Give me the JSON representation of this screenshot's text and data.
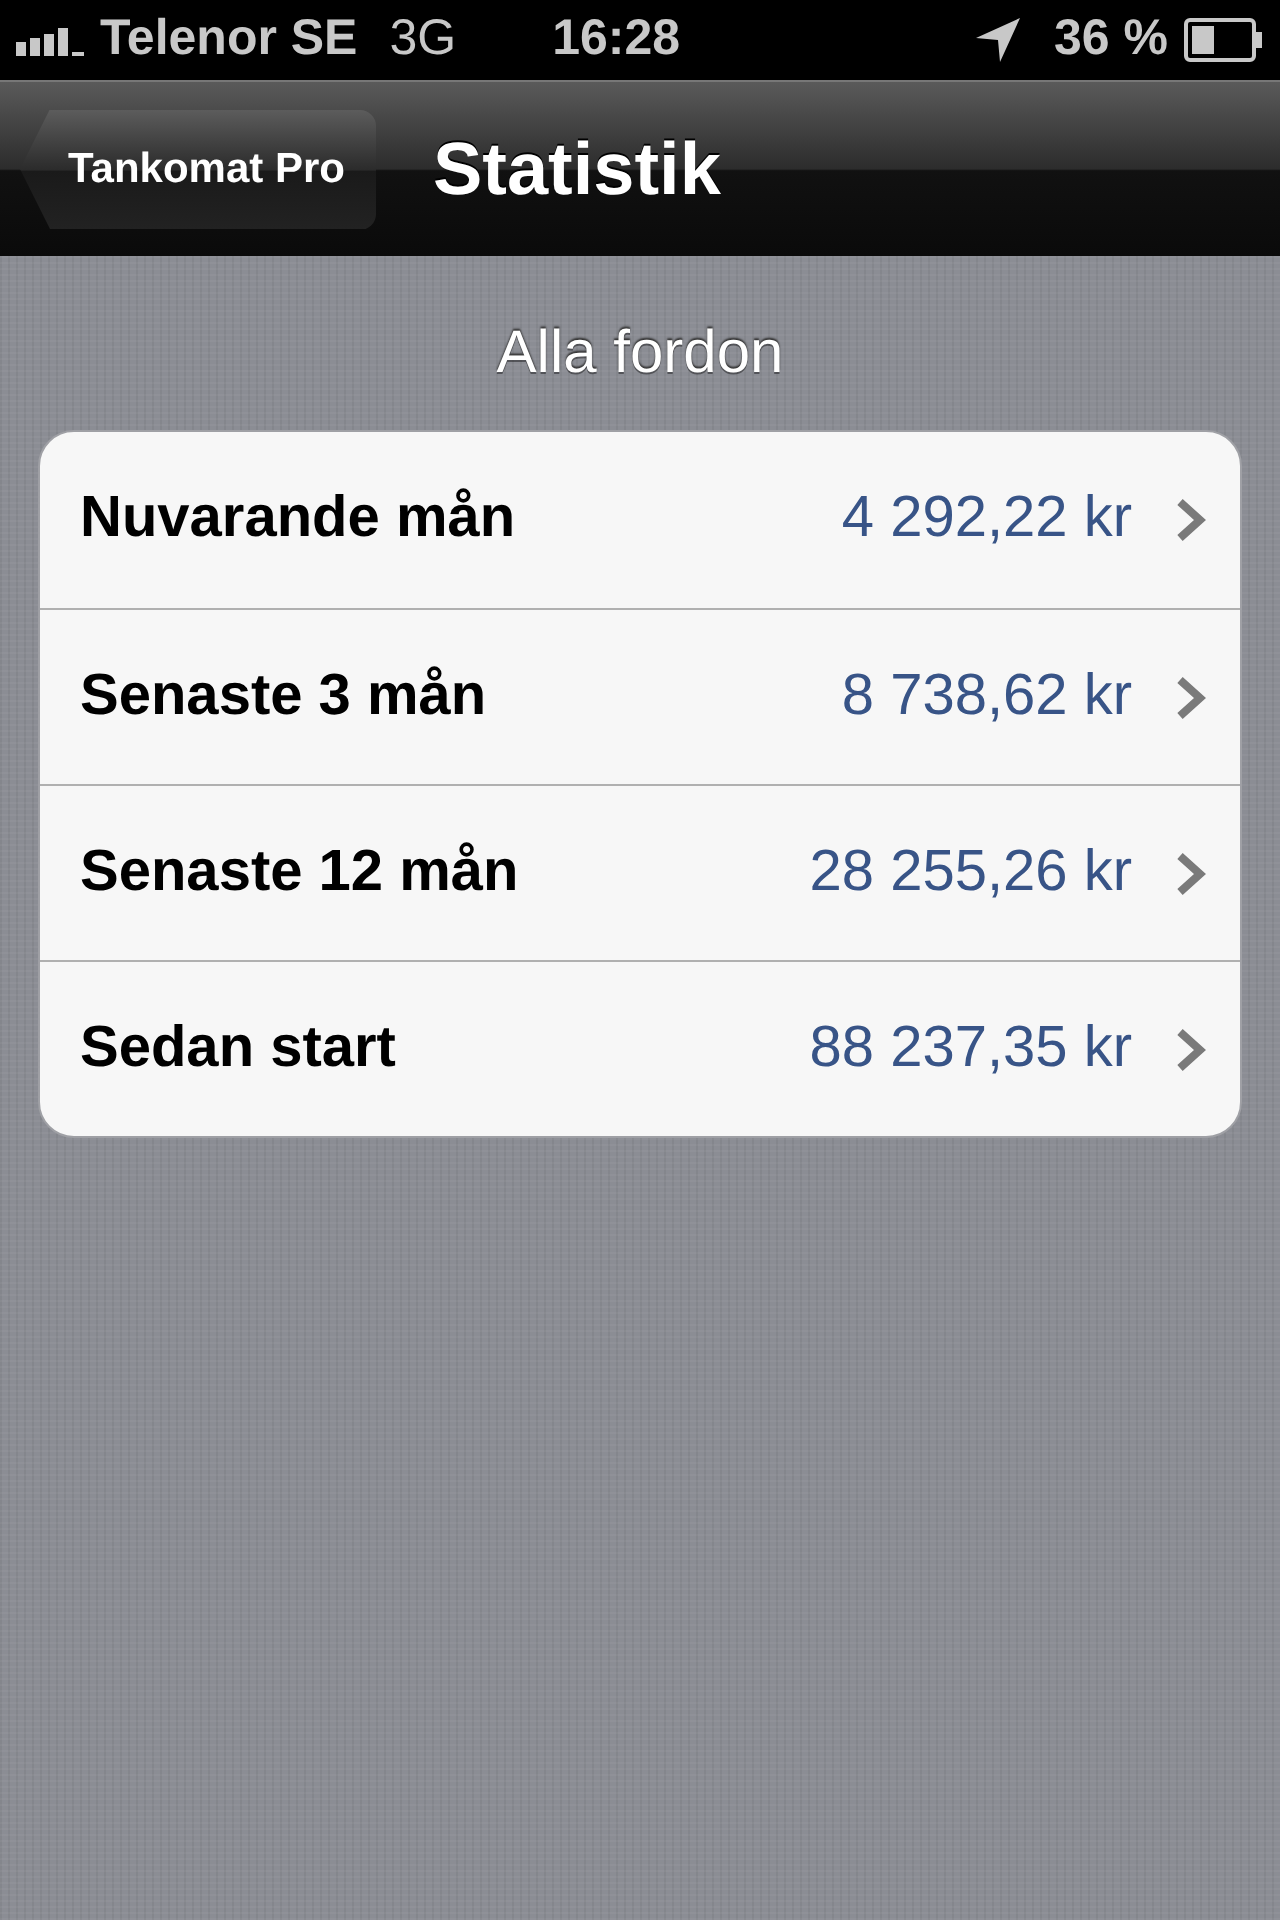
{
  "status_bar": {
    "carrier": "Telenor SE",
    "network": "3G",
    "time": "16:28",
    "battery": "36 %"
  },
  "nav_bar": {
    "back_button": "Tankomat Pro",
    "title": "Statistik"
  },
  "section": {
    "header": "Alla fordon",
    "rows": [
      {
        "label": "Nuvarande mån",
        "value": "4 292,22 kr"
      },
      {
        "label": "Senaste 3 mån",
        "value": "8 738,62 kr"
      },
      {
        "label": "Senaste 12 mån",
        "value": "28 255,26 kr"
      },
      {
        "label": "Sedan start",
        "value": "88 237,35 kr"
      }
    ]
  }
}
